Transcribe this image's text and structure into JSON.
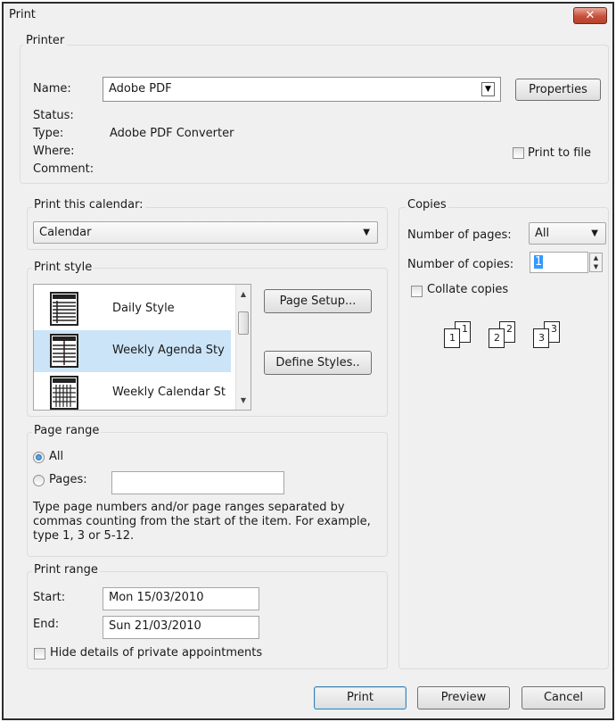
{
  "window": {
    "title": "Print",
    "close_label": "✕"
  },
  "printer": {
    "group_label": "Printer",
    "name_label": "Name:",
    "name_value": "Adobe PDF",
    "properties_button": "Properties",
    "status_label": "Status:",
    "status_value": "",
    "type_label": "Type:",
    "type_value": "Adobe PDF Converter",
    "where_label": "Where:",
    "where_value": "",
    "comment_label": "Comment:",
    "comment_value": "",
    "print_to_file_label": "Print to file",
    "print_to_file_checked": false
  },
  "print_this_calendar": {
    "group_label": "Print this calendar:",
    "selected": "Calendar"
  },
  "print_style": {
    "group_label": "Print style",
    "items": [
      {
        "label": "Daily Style",
        "icon": "daily-style-icon",
        "selected": false
      },
      {
        "label": "Weekly Agenda Sty",
        "icon": "weekly-agenda-style-icon",
        "selected": true
      },
      {
        "label": "Weekly Calendar St",
        "icon": "weekly-calendar-style-icon",
        "selected": false
      }
    ],
    "page_setup_button": "Page Setup...",
    "define_styles_button": "Define Styles.."
  },
  "page_range": {
    "group_label": "Page range",
    "all_label": "All",
    "pages_label": "Pages:",
    "pages_value": "",
    "selected": "All",
    "help_text": "Type page numbers and/or page ranges separated by commas counting from the start of the item.  For example, type 1, 3 or 5-12."
  },
  "print_range": {
    "group_label": "Print range",
    "start_label": "Start:",
    "start_value": "Mon 15/03/2010",
    "end_label": "End:",
    "end_value": "Sun 21/03/2010",
    "hide_private_label": "Hide details of private appointments",
    "hide_private_checked": false
  },
  "copies": {
    "group_label": "Copies",
    "number_of_pages_label": "Number of pages:",
    "number_of_pages_value": "All",
    "number_of_copies_label": "Number of copies:",
    "number_of_copies_value": "1",
    "collate_label": "Collate copies",
    "collate_checked": false,
    "collate_preview": [
      {
        "back": "1",
        "front": "1"
      },
      {
        "back": "2",
        "front": "2"
      },
      {
        "back": "3",
        "front": "3"
      }
    ]
  },
  "footer": {
    "print_button": "Print",
    "preview_button": "Preview",
    "cancel_button": "Cancel"
  }
}
